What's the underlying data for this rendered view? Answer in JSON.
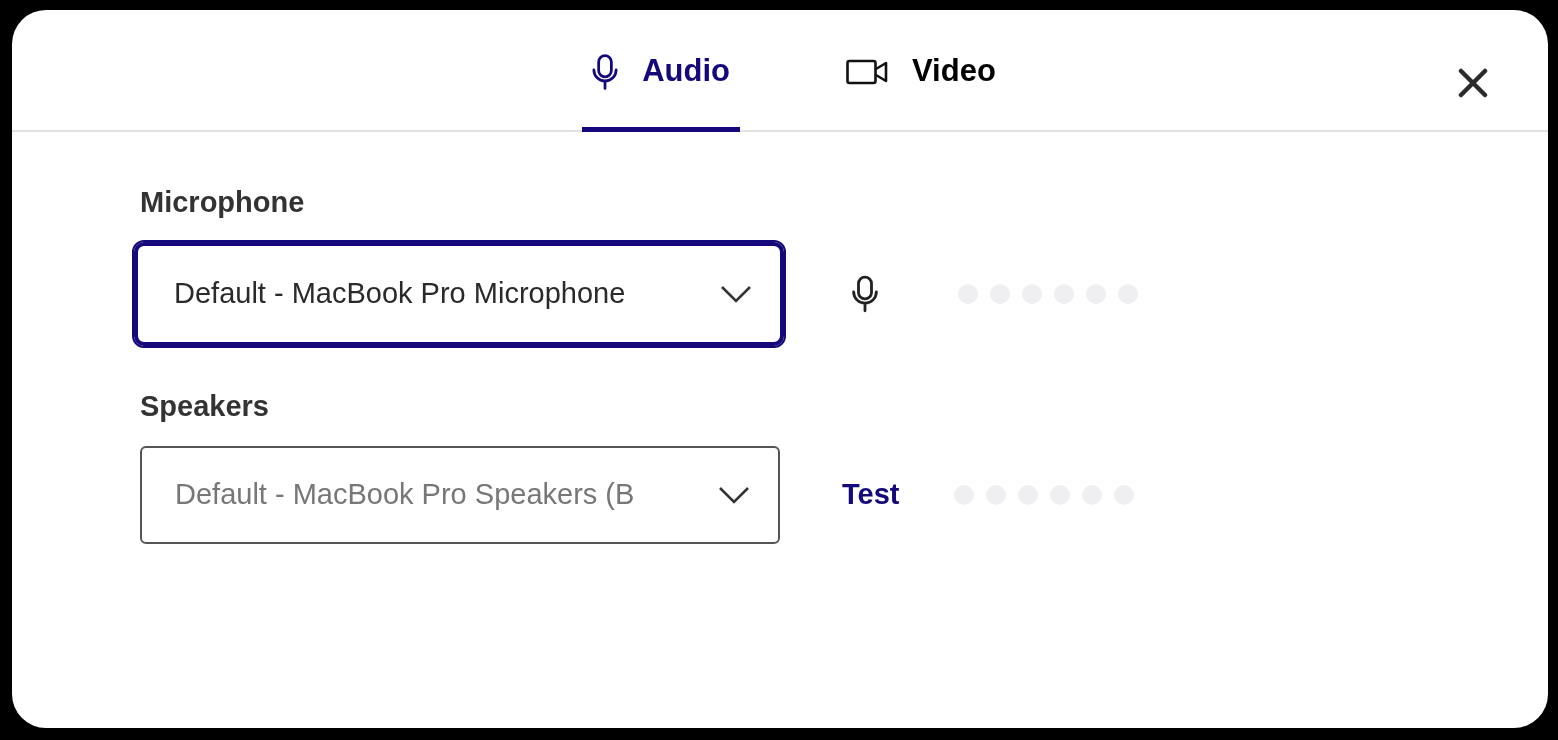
{
  "tabs": [
    {
      "label": "Audio",
      "kind": "microphone",
      "selected": true
    },
    {
      "label": "Video",
      "kind": "camera",
      "selected": false
    }
  ],
  "devices": [
    {
      "label": "Microphone",
      "value": "Default - MacBook Pro Microphone",
      "focused": true,
      "action": {
        "kind": "icon"
      }
    },
    {
      "label": "Speakers",
      "value": "Default - MacBook Pro Speakers (B",
      "focused": false,
      "action": {
        "kind": "link",
        "text": "Test"
      }
    }
  ]
}
